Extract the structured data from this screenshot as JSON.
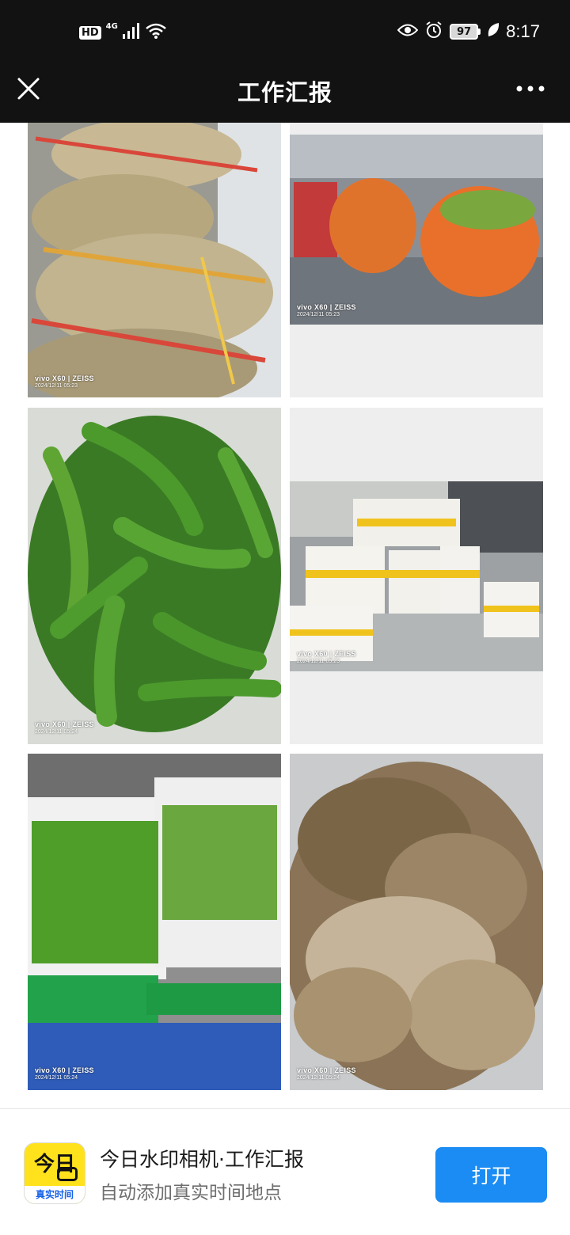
{
  "status_bar": {
    "hd": "HD",
    "network": "4G",
    "battery": "97",
    "time": "8:17",
    "icons": [
      "signal-icon",
      "wifi-icon",
      "eye-icon",
      "alarm-icon",
      "battery-icon",
      "leaf-icon"
    ]
  },
  "title_bar": {
    "title": "工作汇报",
    "close_icon": "close-icon",
    "more_icon": "more-icon"
  },
  "photos": [
    {
      "subject": "potatoes",
      "watermark_brand": "vivo X60 | ZEISS",
      "watermark_time": "2024/12/11 05:23"
    },
    {
      "subject": "carrots",
      "watermark_brand": "vivo X60 | ZEISS",
      "watermark_time": "2024/12/11 05:23"
    },
    {
      "subject": "green peppers",
      "watermark_brand": "vivo X60 | ZEISS",
      "watermark_time": "2024/12/11 05:24"
    },
    {
      "subject": "packaged tofu",
      "watermark_brand": "vivo X60 | ZEISS",
      "watermark_time": "2024/12/11 05:23"
    },
    {
      "subject": "green vegetables in crates",
      "watermark_brand": "vivo X60 | ZEISS",
      "watermark_time": "2024/12/11 05:24"
    },
    {
      "subject": "ginger",
      "watermark_brand": "vivo X60 | ZEISS",
      "watermark_time": "2024/12/11 05:24"
    }
  ],
  "banner": {
    "app_icon_text_top": "今日",
    "app_icon_text_bottom": "真实时间",
    "app_name": "今日水印相机·工作汇报",
    "app_desc": "自动添加真实时间地点",
    "open_label": "打开"
  },
  "colors": {
    "topbar": "#121212",
    "open_button": "#1a8cf3",
    "app_icon": "#ffe21c"
  }
}
